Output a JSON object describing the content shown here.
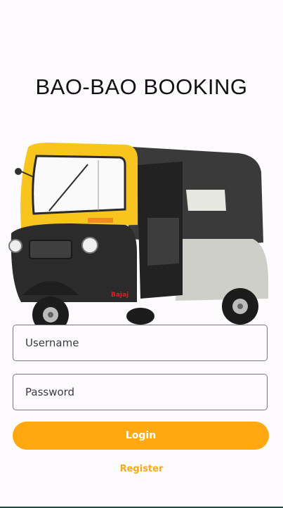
{
  "app": {
    "title": "BAO-BAO BOOKING"
  },
  "hero": {
    "image": "auto-rickshaw-illustration",
    "decal_text": "Bajaj"
  },
  "form": {
    "username_placeholder": "Username",
    "password_placeholder": "Password",
    "login_label": "Login",
    "register_label": "Register"
  },
  "colors": {
    "accent": "#ffa80f",
    "rickshaw_yellow": "#f7c51e",
    "rickshaw_body": "#2d2d2d",
    "background": "#fdfbfe"
  }
}
